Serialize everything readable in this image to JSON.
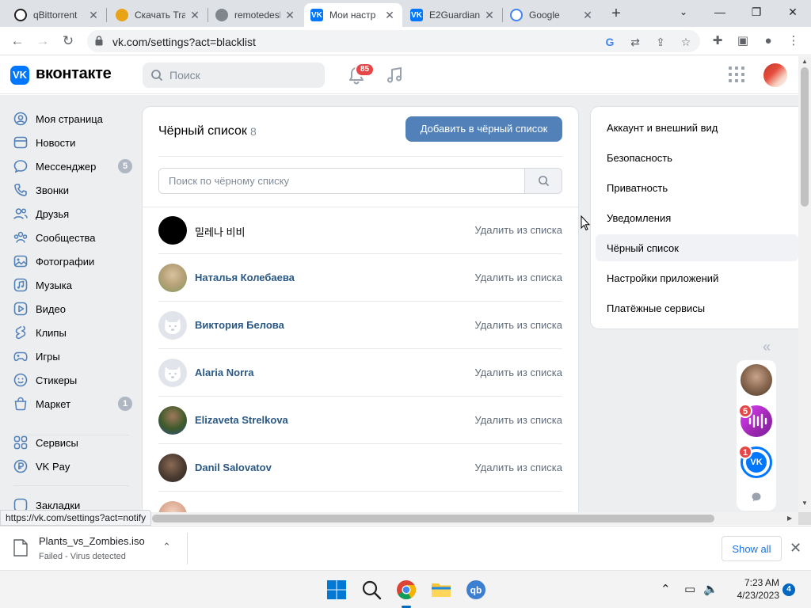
{
  "browser": {
    "tabs": [
      {
        "title": "qBittorrent",
        "active": false
      },
      {
        "title": "Скачать Tra",
        "active": false
      },
      {
        "title": "remotedesk",
        "active": false
      },
      {
        "title": "Мои настр",
        "active": true
      },
      {
        "title": "E2Guardian",
        "active": false
      },
      {
        "title": "Google",
        "active": false
      }
    ],
    "url": "vk.com/settings?act=blacklist",
    "status_url": "https://vk.com/settings?act=notify"
  },
  "vk": {
    "brand": "вконтакте",
    "search_placeholder": "Поиск",
    "notifications_count": "85",
    "left_menu": [
      {
        "label": "Моя страница",
        "icon": "user-circle-icon"
      },
      {
        "label": "Новости",
        "icon": "news-icon"
      },
      {
        "label": "Мессенджер",
        "icon": "message-icon",
        "badge": "5"
      },
      {
        "label": "Звонки",
        "icon": "phone-icon"
      },
      {
        "label": "Друзья",
        "icon": "friends-icon"
      },
      {
        "label": "Сообщества",
        "icon": "communities-icon"
      },
      {
        "label": "Фотографии",
        "icon": "photo-icon"
      },
      {
        "label": "Музыка",
        "icon": "music-icon"
      },
      {
        "label": "Видео",
        "icon": "video-icon"
      },
      {
        "label": "Клипы",
        "icon": "clips-icon"
      },
      {
        "label": "Игры",
        "icon": "gamepad-icon"
      },
      {
        "label": "Стикеры",
        "icon": "sticker-icon"
      },
      {
        "label": "Маркет",
        "icon": "market-icon",
        "badge": "1"
      },
      {
        "label": "Сервисы",
        "icon": "services-icon"
      },
      {
        "label": "VK Pay",
        "icon": "vkpay-icon"
      },
      {
        "label": "Закладки",
        "icon": "bookmark-icon"
      }
    ],
    "blacklist": {
      "title": "Чёрный список",
      "count": "8",
      "add_button": "Добавить в чёрный список",
      "search_placeholder": "Поиск по чёрному списку",
      "remove_label": "Удалить из списка",
      "entries": [
        {
          "name": "밀레나 비비"
        },
        {
          "name": "Наталья Колебаева"
        },
        {
          "name": "Виктория Белова"
        },
        {
          "name": "Alaria Norra"
        },
        {
          "name": "Elizaveta Strelkova"
        },
        {
          "name": "Danil Salovatov"
        }
      ]
    },
    "settings_menu": [
      "Аккаунт и внешний вид",
      "Безопасность",
      "Приватность",
      "Уведомления",
      "Чёрный список",
      "Настройки приложений",
      "Платёжные сервисы"
    ],
    "settings_active": "Чёрный список",
    "chat_badges": [
      "5",
      "1"
    ]
  },
  "download": {
    "filename": "Plants_vs_Zombies.iso",
    "status": "Failed - Virus detected",
    "show_all": "Show all"
  },
  "taskbar": {
    "time": "7:23 AM",
    "date": "4/23/2023",
    "notifications": "4"
  },
  "colors": {
    "vk_blue": "#0077ff",
    "button_blue": "#5181b8",
    "link_blue": "#2a5885",
    "badge_red": "#e64646"
  }
}
